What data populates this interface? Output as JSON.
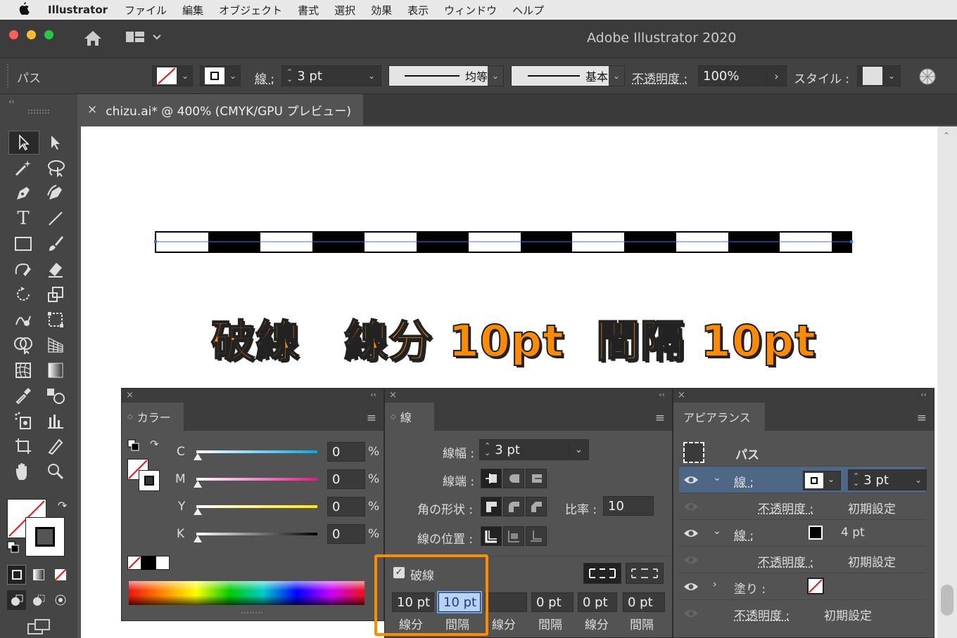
{
  "menubar": {
    "app": "Illustrator",
    "items": [
      "ファイル",
      "編集",
      "オブジェクト",
      "書式",
      "選択",
      "効果",
      "表示",
      "ウィンドウ",
      "ヘルプ"
    ]
  },
  "window": {
    "title": "Adobe Illustrator 2020"
  },
  "control": {
    "object_type": "パス",
    "stroke_label": "線 :",
    "stroke_weight": "3 pt",
    "profile1": "均等",
    "profile2": "基本",
    "opacity_label": "不透明度 :",
    "opacity": "100%",
    "style_label": "スタイル :"
  },
  "doc_tab": {
    "close": "×",
    "title": "chizu.ai* @ 400% (CMYK/GPU プレビュー)"
  },
  "canvas": {
    "caption": "破線　線分 10pt  間隔 10pt"
  },
  "color_panel": {
    "title": "カラー",
    "channels": [
      {
        "label": "C",
        "value": "0",
        "unit": "%",
        "color": "#00a8e8"
      },
      {
        "label": "M",
        "value": "0",
        "unit": "%",
        "color": "#e8148c"
      },
      {
        "label": "Y",
        "value": "0",
        "unit": "%",
        "color": "#ffe800"
      },
      {
        "label": "K",
        "value": "0",
        "unit": "%",
        "color": "#000000"
      }
    ]
  },
  "stroke_panel": {
    "title": "線",
    "weight_label": "線幅 :",
    "weight": "3 pt",
    "cap_label": "線端 :",
    "join_label": "角の形状 :",
    "limit_label": "比率 :",
    "limit": "10",
    "align_label": "線の位置 :",
    "dashed_label": "破線",
    "dashed": true,
    "dash_fields": [
      {
        "value": "10 pt",
        "label": "線分"
      },
      {
        "value": "10 pt",
        "label": "間隔"
      },
      {
        "value": "",
        "label": "線分"
      },
      {
        "value": "0 pt",
        "label": "間隔"
      },
      {
        "value": "0 pt",
        "label": "線分"
      },
      {
        "value": "0 pt",
        "label": "間隔"
      }
    ]
  },
  "appearance_panel": {
    "title": "アピアランス",
    "object": "パス",
    "stroke1": {
      "label": "線 :",
      "weight": "3 pt"
    },
    "opacity1": {
      "label": "不透明度 :",
      "value": "初期設定"
    },
    "stroke2": {
      "label": "線 :",
      "weight": "4 pt"
    },
    "opacity2": {
      "label": "不透明度 :",
      "value": "初期設定"
    },
    "fill": {
      "label": "塗り :"
    },
    "opacity3": {
      "label": "不透明度 :",
      "value": "初期設定"
    }
  },
  "colors": {
    "highlight": "#ff8c00",
    "selection": "#3f6fe6",
    "panel_bg": "#535353",
    "dark_bg": "#3c3c3c"
  }
}
